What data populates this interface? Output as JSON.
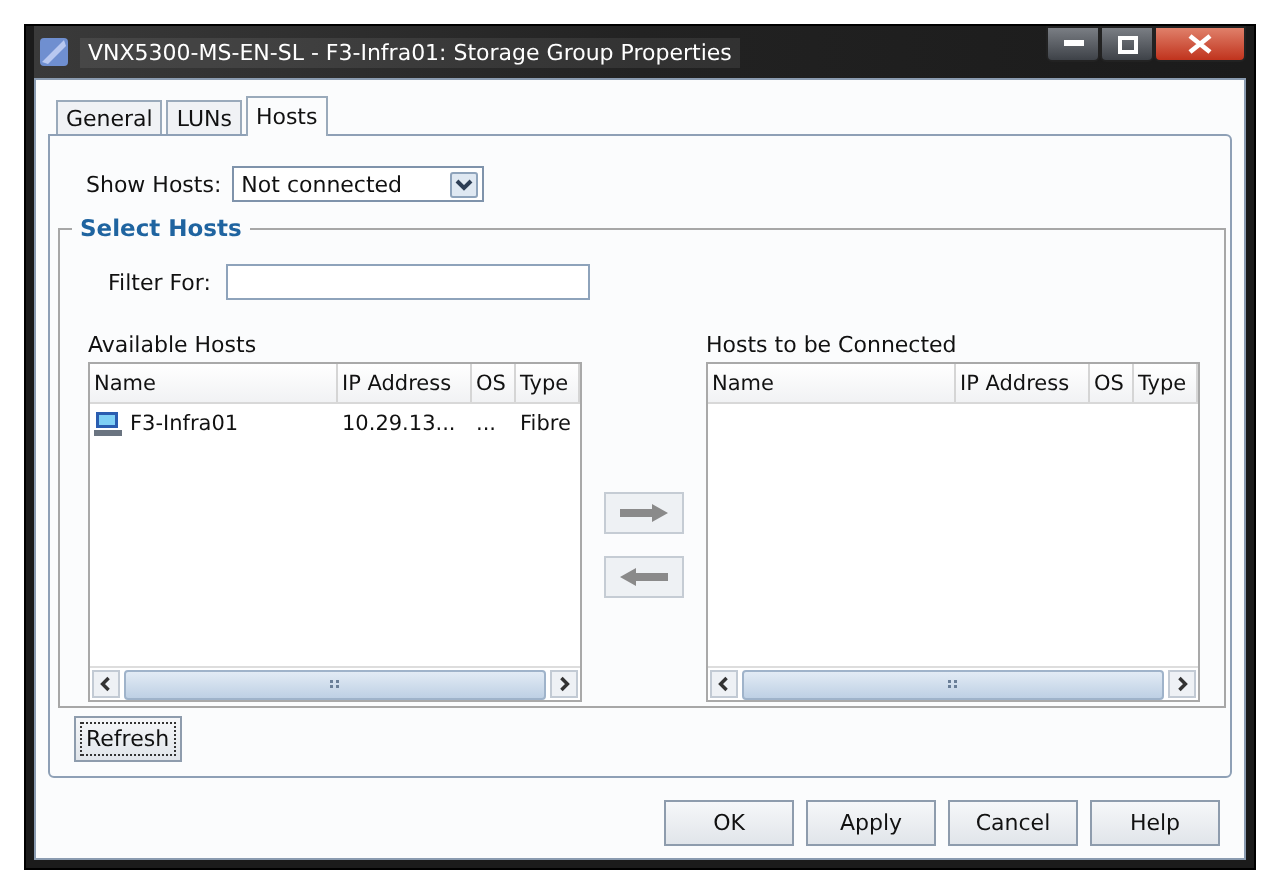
{
  "window": {
    "title": "VNX5300-MS-EN-SL - F3-Infra01: Storage Group Properties"
  },
  "tabs": [
    {
      "label": "General",
      "selected": false
    },
    {
      "label": "LUNs",
      "selected": false
    },
    {
      "label": "Hosts",
      "selected": true
    }
  ],
  "show_hosts": {
    "label": "Show Hosts:",
    "value": "Not connected"
  },
  "select_hosts": {
    "title": "Select Hosts",
    "filter_label": "Filter For:"
  },
  "available_hosts": {
    "title": "Available Hosts",
    "columns": [
      "Name",
      "IP Address",
      "OS",
      "Type"
    ],
    "rows": [
      {
        "name": "F3-Infra01",
        "ip": "10.29.13...",
        "os": "...",
        "type": "Fibre"
      }
    ]
  },
  "hosts_to_connect": {
    "title": "Hosts to be Connected",
    "columns": [
      "Name",
      "IP Address",
      "OS",
      "Type"
    ]
  },
  "refresh_button": "Refresh",
  "buttons": [
    "OK",
    "Apply",
    "Cancel",
    "Help"
  ]
}
